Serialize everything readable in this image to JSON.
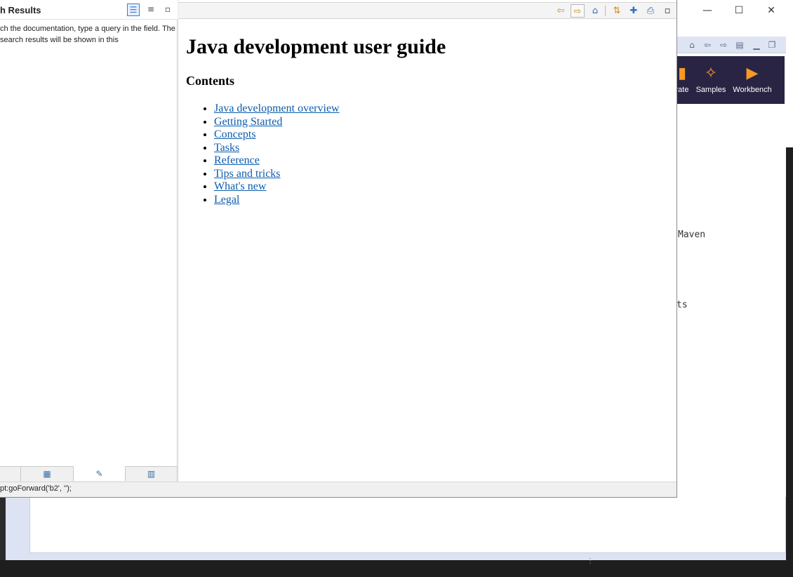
{
  "window_controls": {
    "minimize": "—",
    "maximize": "☐",
    "close": "✕"
  },
  "welcome": {
    "items": [
      {
        "label": "rate",
        "icon": "box-icon"
      },
      {
        "label": "Samples",
        "icon": "magic-wand-icon"
      },
      {
        "label": "Workbench",
        "icon": "play-icon"
      }
    ]
  },
  "ide_text": {
    "maven": "Maven",
    "ts": "ts"
  },
  "search": {
    "title": "h Results",
    "message": "ch the documentation, type a query in the field. The search results will be shown in this"
  },
  "document": {
    "title": "Java development user guide",
    "contents_heading": "Contents",
    "links": [
      "Java development overview",
      "Getting Started",
      "Concepts",
      "Tasks",
      "Reference",
      "Tips and tricks",
      "What's new",
      "Legal"
    ]
  },
  "status": {
    "text": "pt:goForward('b2', '');"
  },
  "colors": {
    "accent_orange": "#f59a23",
    "banner_bg": "#2a2444",
    "link": "#0b5cad",
    "toolbar_icon": "#d08a19"
  }
}
